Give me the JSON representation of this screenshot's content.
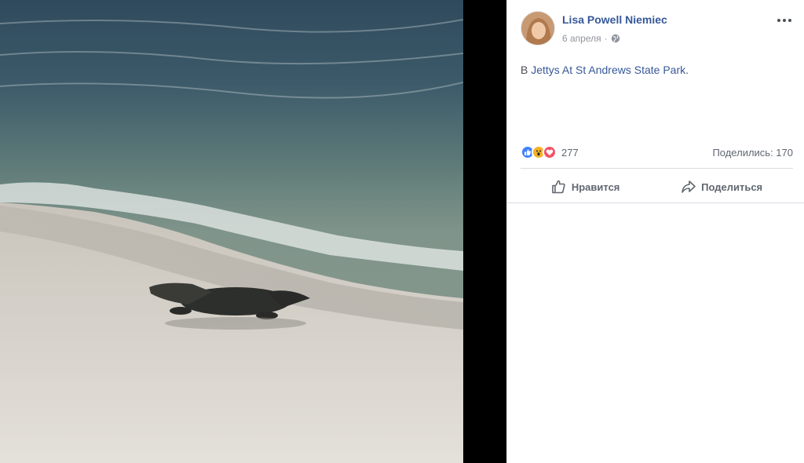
{
  "post": {
    "author": "Lisa Powell Niemiec",
    "date": "6 апреля",
    "separator": "·",
    "location_prefix": "В",
    "location_name": "Jettys At St Andrews State Park",
    "location_suffix": "."
  },
  "stats": {
    "reaction_count": "277",
    "shares": "Поделились: 170",
    "reactions": [
      "like-icon",
      "wow-icon",
      "love-icon"
    ]
  },
  "actions": {
    "like_label": "Нравится",
    "share_label": "Поделиться"
  },
  "photo": {
    "subject": "alligator-on-beach"
  },
  "colors": {
    "link": "#365899",
    "meta": "#90949c",
    "like": "#4080ff",
    "wow": "#f7b125",
    "love": "#f25268"
  }
}
